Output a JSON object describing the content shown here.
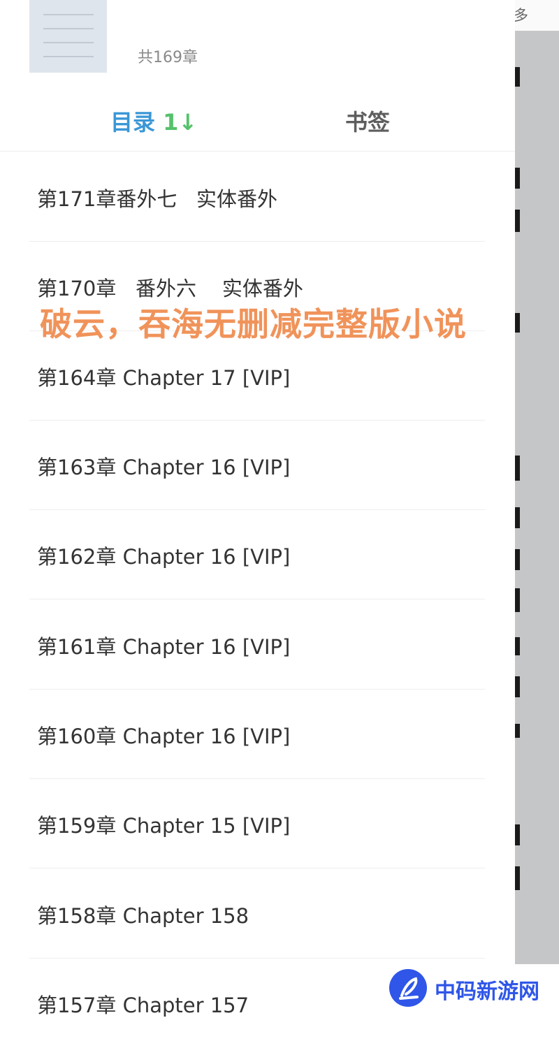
{
  "reader": {
    "top_label": "多"
  },
  "header": {
    "chapter_count": "共169章"
  },
  "tabs": [
    {
      "label": "目录",
      "sort_icon_text": "1↓",
      "active": true
    },
    {
      "label": "书签",
      "active": false
    }
  ],
  "chapters": [
    {
      "title": "第171章番外七   实体番外"
    },
    {
      "title": "第170章   番外六    实体番外"
    },
    {
      "title": "第164章 Chapter 17 [VIP]"
    },
    {
      "title": "第163章 Chapter 16 [VIP]"
    },
    {
      "title": "第162章 Chapter 16 [VIP]"
    },
    {
      "title": "第161章 Chapter 16 [VIP]"
    },
    {
      "title": "第160章 Chapter 16 [VIP]"
    },
    {
      "title": "第159章 Chapter 15 [VIP]"
    },
    {
      "title": "第158章 Chapter 158"
    },
    {
      "title": "第157章 Chapter 157"
    }
  ],
  "overlay": {
    "watermark_text": "破云，吞海无删减完整版小说",
    "brand_text": "中码新游网"
  },
  "colors": {
    "active_tab": "#3a97d6",
    "sort_icon": "#55c26a",
    "watermark": "#f0935a",
    "brand": "#2f56e8"
  }
}
